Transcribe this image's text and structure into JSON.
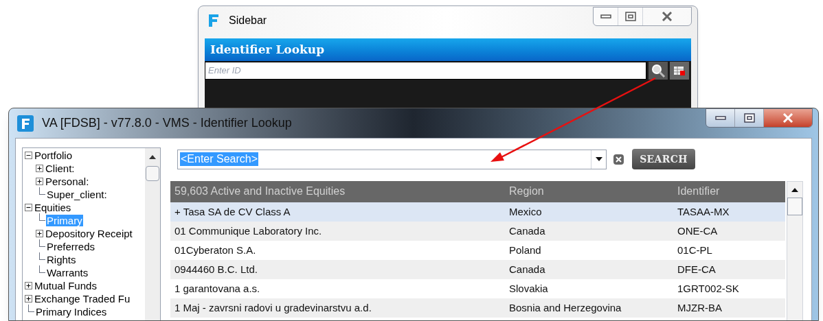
{
  "sidebar_window": {
    "title": "Sidebar",
    "panel_title": "Identifier Lookup",
    "id_field": {
      "placeholder": "Enter ID"
    }
  },
  "main_window": {
    "title": "VA [FDSB] - v77.8.0 - VMS - Identifier Lookup"
  },
  "tree": [
    {
      "label": "Portfolio",
      "expanded": true,
      "selected": false,
      "children": [
        {
          "label": "Client:",
          "expanded": false,
          "selected": false
        },
        {
          "label": "Personal:",
          "expanded": false,
          "selected": false
        },
        {
          "label": "Super_client:",
          "selected": false
        }
      ]
    },
    {
      "label": "Equities",
      "expanded": true,
      "selected": false,
      "children": [
        {
          "label": "Primary",
          "selected": true
        },
        {
          "label": "Depository Receipt",
          "expanded": false,
          "selected": false
        },
        {
          "label": "Preferreds",
          "selected": false
        },
        {
          "label": "Rights",
          "selected": false
        },
        {
          "label": "Warrants",
          "selected": false
        }
      ]
    },
    {
      "label": "Mutual Funds",
      "expanded": false,
      "selected": false
    },
    {
      "label": "Exchange Traded Fu",
      "expanded": false,
      "selected": false
    },
    {
      "label": "Primary Indices",
      "selected": false
    }
  ],
  "search": {
    "value": "<Enter Search>",
    "button": "SEARCH"
  },
  "table": {
    "columns": [
      "59,603 Active and Inactive Equities",
      "Region",
      "Identifier"
    ],
    "rows": [
      {
        "cells": [
          "+ Tasa SA de CV Class A",
          "Mexico",
          "TASAA-MX"
        ],
        "selected": true
      },
      {
        "cells": [
          "01 Communique Laboratory Inc.",
          "Canada",
          "ONE-CA"
        ],
        "selected": false
      },
      {
        "cells": [
          "01Cyberaton S.A.",
          "Poland",
          "01C-PL"
        ],
        "selected": false
      },
      {
        "cells": [
          "0944460 B.C. Ltd.",
          "Canada",
          "DFE-CA"
        ],
        "selected": false
      },
      {
        "cells": [
          "1 garantovana a.s.",
          "Slovakia",
          "1GRT002-SK"
        ],
        "selected": false
      },
      {
        "cells": [
          "1 Maj - zavrsni radovi u gradevinarstvu a.d.",
          "Bosnia and Herzegovina",
          "MJZR-BA"
        ],
        "selected": false
      }
    ]
  }
}
